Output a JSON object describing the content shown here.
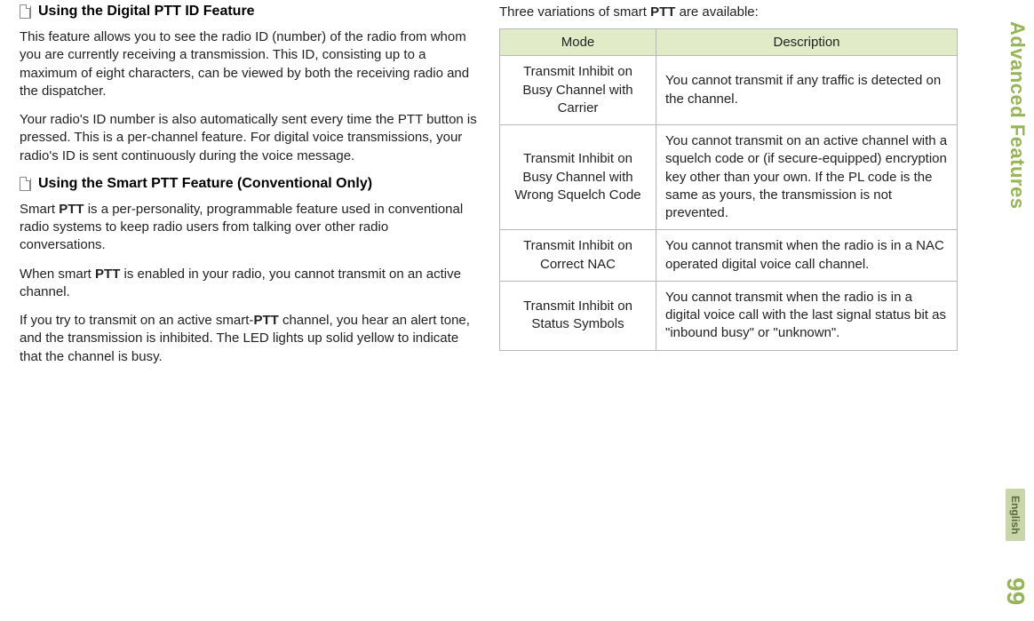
{
  "left": {
    "heading1": "Using the Digital PTT ID Feature",
    "p1": "This feature allows you to see the radio ID (number) of the radio from whom you are currently receiving a transmission. This ID, consisting up to a maximum of eight characters, can be viewed by both the receiving radio and the dispatcher.",
    "p2": "Your radio's ID number is also automatically sent every time the PTT button is pressed. This is a per-channel feature. For digital voice transmissions, your radio's ID is sent continuously during the voice message.",
    "heading2": "Using the Smart PTT Feature (Conventional Only)",
    "p3_prefix": "Smart ",
    "p3_bold": "PTT",
    "p3_suffix": " is a per-personality, programmable feature used in conventional radio systems to keep radio users from talking over other radio conversations.",
    "p4_prefix": "When smart ",
    "p4_bold": "PTT",
    "p4_suffix": " is enabled in your radio, you cannot transmit on an active channel.",
    "p5_prefix": "If you try to transmit on an active smart-",
    "p5_bold": "PTT",
    "p5_suffix": " channel, you hear an alert tone, and the transmission is inhibited. The LED lights up solid yellow to indicate that the channel is busy."
  },
  "right": {
    "intro_prefix": "Three variations of smart ",
    "intro_bold": "PTT",
    "intro_suffix": " are available:",
    "th_mode": "Mode",
    "th_desc": "Description",
    "rows": [
      {
        "mode": "Transmit Inhibit on Busy Channel with Carrier",
        "desc": "You cannot transmit if any traffic is detected on the channel."
      },
      {
        "mode": "Transmit Inhibit on Busy Channel with Wrong Squelch Code",
        "desc": "You cannot transmit on an active channel with a squelch code or (if secure-equipped) encryption key other than your own. If the PL code is the same as yours, the transmission is not prevented."
      },
      {
        "mode": "Transmit Inhibit on Correct NAC",
        "desc": "You cannot transmit when the radio is in a NAC operated digital voice call channel."
      },
      {
        "mode": "Transmit Inhibit on Status Symbols",
        "desc": "You cannot transmit when the radio is in a digital voice call with the last signal status bit as \"inbound busy\" or \"unknown\"."
      }
    ]
  },
  "rail": {
    "section": "Advanced Features",
    "page": "99",
    "lang": "English"
  }
}
